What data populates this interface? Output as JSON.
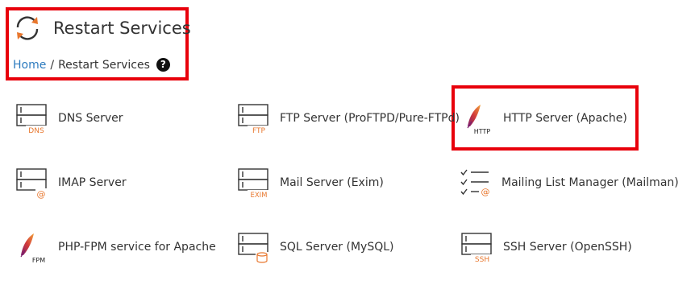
{
  "header": {
    "title": "Restart Services",
    "icon": "restart-services-icon"
  },
  "breadcrumb": {
    "home": "Home",
    "separator": "/",
    "current": "Restart Services",
    "help_glyph": "?"
  },
  "services": [
    {
      "label": "DNS Server",
      "badge": "DNS",
      "icon": "server-dns-icon"
    },
    {
      "label": "FTP Server (ProFTPD/Pure-FTPd)",
      "badge": "FTP",
      "icon": "server-ftp-icon"
    },
    {
      "label": "HTTP Server (Apache)",
      "badge": "HTTP",
      "icon": "apache-feather-icon"
    },
    {
      "label": "IMAP Server",
      "badge": "@",
      "icon": "server-imap-icon"
    },
    {
      "label": "Mail Server (Exim)",
      "badge": "EXIM",
      "icon": "server-exim-icon"
    },
    {
      "label": "Mailing List Manager (Mailman)",
      "badge": "@",
      "icon": "mailing-list-checklist-icon"
    },
    {
      "label": "PHP-FPM service for Apache",
      "badge": "FPM",
      "icon": "apache-feather-icon"
    },
    {
      "label": "SQL Server (MySQL)",
      "badge": "",
      "icon": "server-database-icon"
    },
    {
      "label": "SSH Server (OpenSSH)",
      "badge": "SSH",
      "icon": "server-ssh-icon"
    }
  ],
  "colors": {
    "accent_orange": "#e8772e",
    "link_blue": "#2d7bbf",
    "highlight_red": "#e8000b",
    "text": "#333333"
  }
}
